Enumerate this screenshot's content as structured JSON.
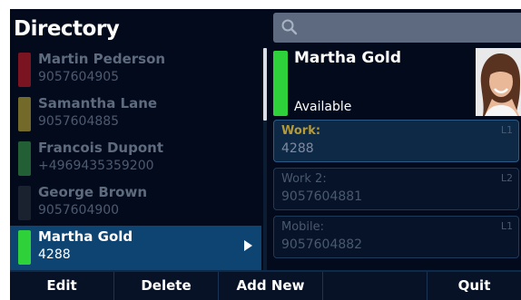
{
  "header": {
    "title": "Directory",
    "search_placeholder": ""
  },
  "contacts": [
    {
      "name": "Martin Pederson",
      "number": "9057604905",
      "status_color": "#7a1420",
      "selected": false
    },
    {
      "name": "Samantha Lane",
      "number": "9057604885",
      "status_color": "#736a2a",
      "selected": false
    },
    {
      "name": "Francois Dupont",
      "number": "+4969435359200",
      "status_color": "#225f35",
      "selected": false
    },
    {
      "name": "George Brown",
      "number": "9057604900",
      "status_color": "#1a2230",
      "selected": false
    },
    {
      "name": "Martha Gold",
      "number": "4288",
      "status_color": "#2fd13a",
      "selected": true
    }
  ],
  "detail": {
    "name": "Martha Gold",
    "status": "Available",
    "status_color": "#2fd13a",
    "phones": [
      {
        "label": "Work:",
        "value": "4288",
        "line": "L1",
        "selected": true
      },
      {
        "label": "Work 2:",
        "value": "9057604881",
        "line": "L2",
        "selected": false
      },
      {
        "label": "Mobile:",
        "value": "9057604882",
        "line": "L1",
        "selected": false
      }
    ]
  },
  "softkeys": [
    {
      "label": "Edit"
    },
    {
      "label": "Delete"
    },
    {
      "label": "Add New"
    },
    {
      "label": ""
    },
    {
      "label": "Quit"
    }
  ],
  "icons": {
    "search": "search-icon",
    "arrow": "arrow-right-icon",
    "avatar": "avatar-photo"
  }
}
